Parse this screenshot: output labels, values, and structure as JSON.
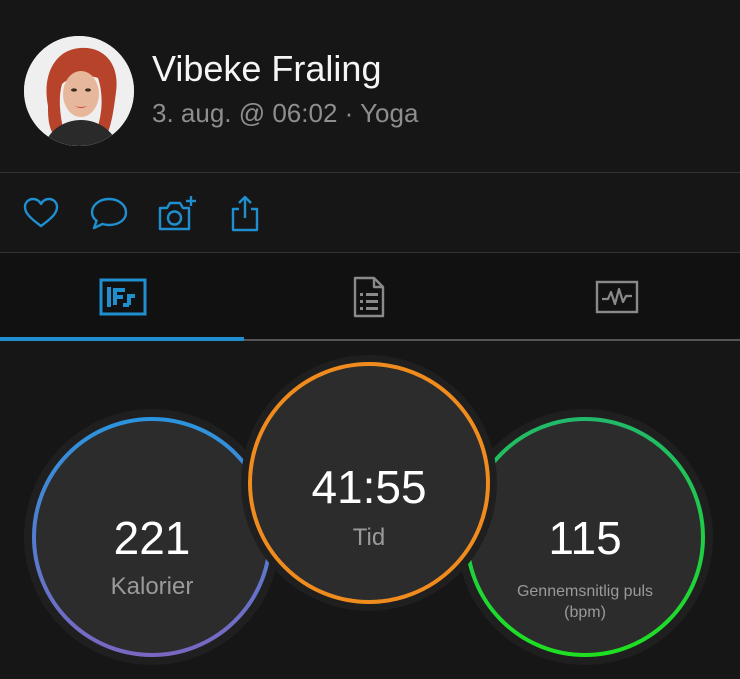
{
  "profile": {
    "name": "Vibeke Fraling",
    "date": "3. aug. @ 06:02",
    "separator": "·",
    "activity_type": "Yoga"
  },
  "actions": [
    {
      "icon": "heart-icon"
    },
    {
      "icon": "comment-icon"
    },
    {
      "icon": "camera-add-icon"
    },
    {
      "icon": "share-icon"
    }
  ],
  "tabs": [
    {
      "icon": "activity-stats-icon",
      "selected": true
    },
    {
      "icon": "details-list-icon",
      "selected": false
    },
    {
      "icon": "chart-icon",
      "selected": false
    }
  ],
  "stats": {
    "calories": {
      "value": "221",
      "label": "Kalorier"
    },
    "time": {
      "value": "41:55",
      "label": "Tid"
    },
    "heart_rate": {
      "value": "115",
      "label_line1": "Gennemsnitlig puls",
      "label_line2": "(bpm)"
    }
  },
  "colors": {
    "accent": "#1f8fd0",
    "calories_ring_top": "#2b94de",
    "calories_ring_bottom": "#7a67c2",
    "time_ring": "#f08b1d",
    "heart_ring_top": "#21b96a",
    "heart_ring_bottom": "#1ee021",
    "background": "#161616"
  }
}
